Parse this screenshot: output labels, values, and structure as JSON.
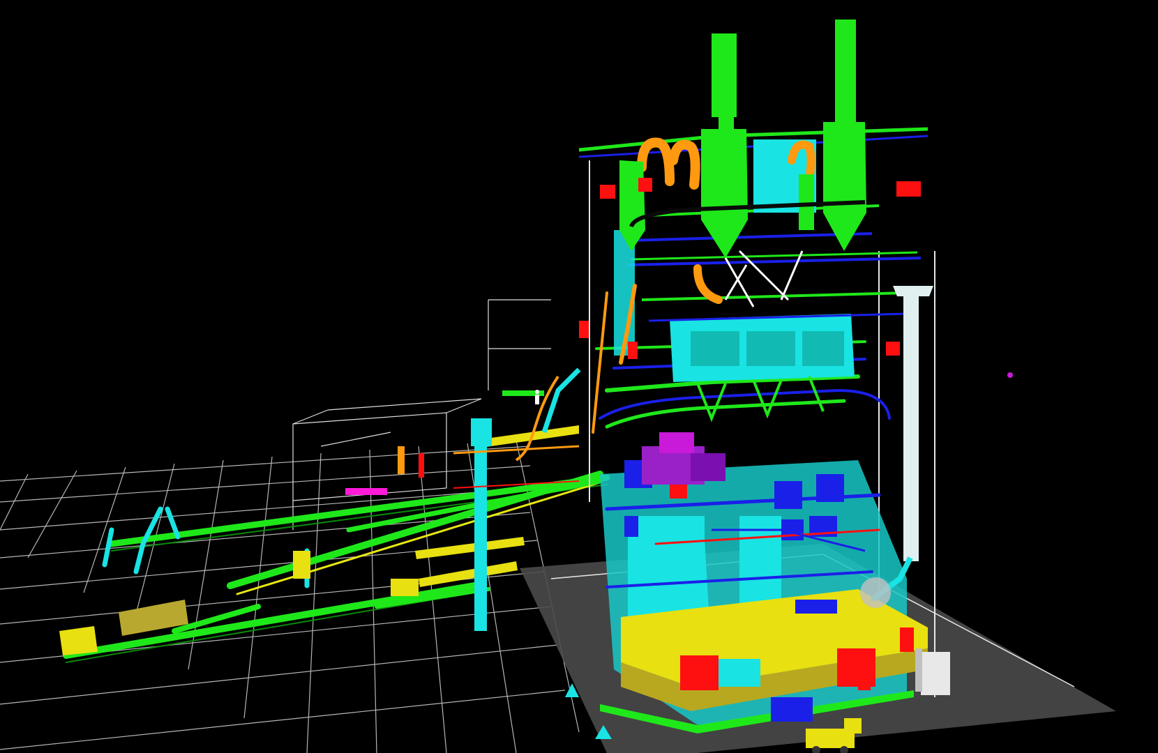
{
  "scene": {
    "background": "#000000",
    "colors": {
      "grid": "#d8d8d8",
      "pad": "#4a4a4a",
      "green": "#1fe81a",
      "cyan": "#19e3e3",
      "yellow": "#f2f20e",
      "orange": "#ff9a10",
      "red": "#ff1010",
      "blue": "#1a20e8",
      "magenta": "#c81ad8",
      "white": "#f4f4f4",
      "teal": "#17c8c0"
    },
    "icons": [
      "worker-figure-icon",
      "mobile-crane-icon",
      "control-cabinet-icon",
      "survey-marker-icon"
    ]
  }
}
